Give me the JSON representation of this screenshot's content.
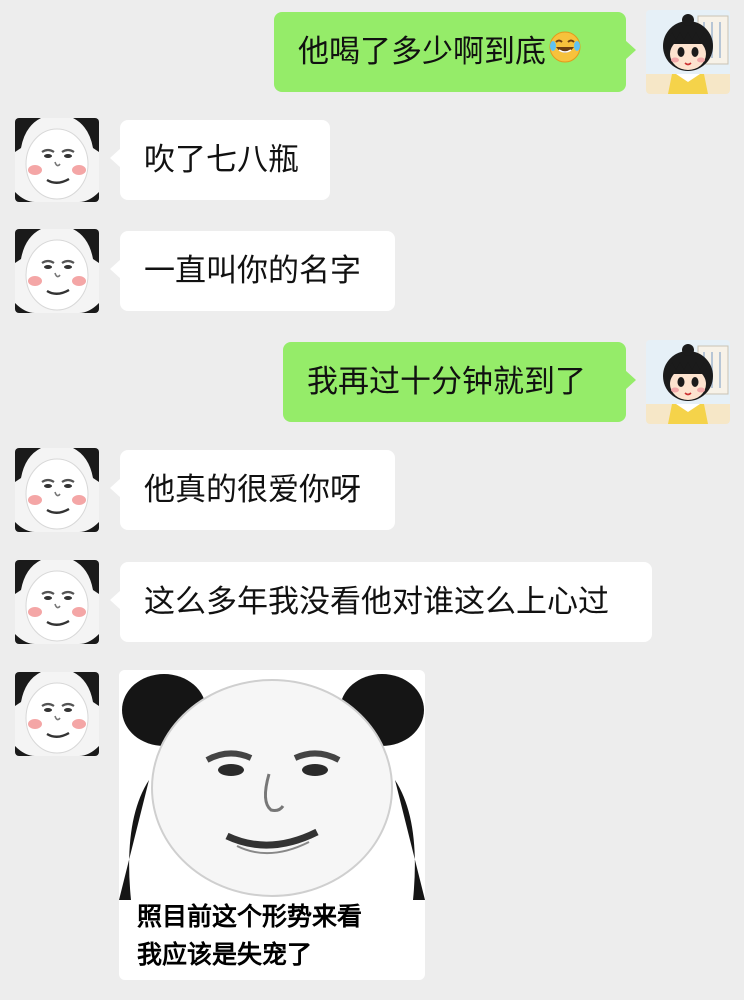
{
  "messages": [
    {
      "side": "out",
      "text": "他喝了多少啊到底",
      "emoji": "laughing-crying-emoji"
    },
    {
      "side": "in",
      "text": "吹了七八瓶"
    },
    {
      "side": "in",
      "text": "一直叫你的名字"
    },
    {
      "side": "out",
      "text": "我再过十分钟就到了"
    },
    {
      "side": "in",
      "text": "他真的很爱你呀"
    },
    {
      "side": "in",
      "text": "这么多年我没看他对谁这么上心过"
    },
    {
      "side": "in",
      "type": "sticker",
      "caption_line1": "照目前这个形势来看",
      "caption_line2": "我应该是失宠了"
    }
  ],
  "colors": {
    "background": "#ededed",
    "outgoing_bubble": "#95ec69",
    "incoming_bubble": "#ffffff"
  },
  "avatars": {
    "me": "cartoon-girl-avatar",
    "friend": "panda-meme-avatar"
  }
}
